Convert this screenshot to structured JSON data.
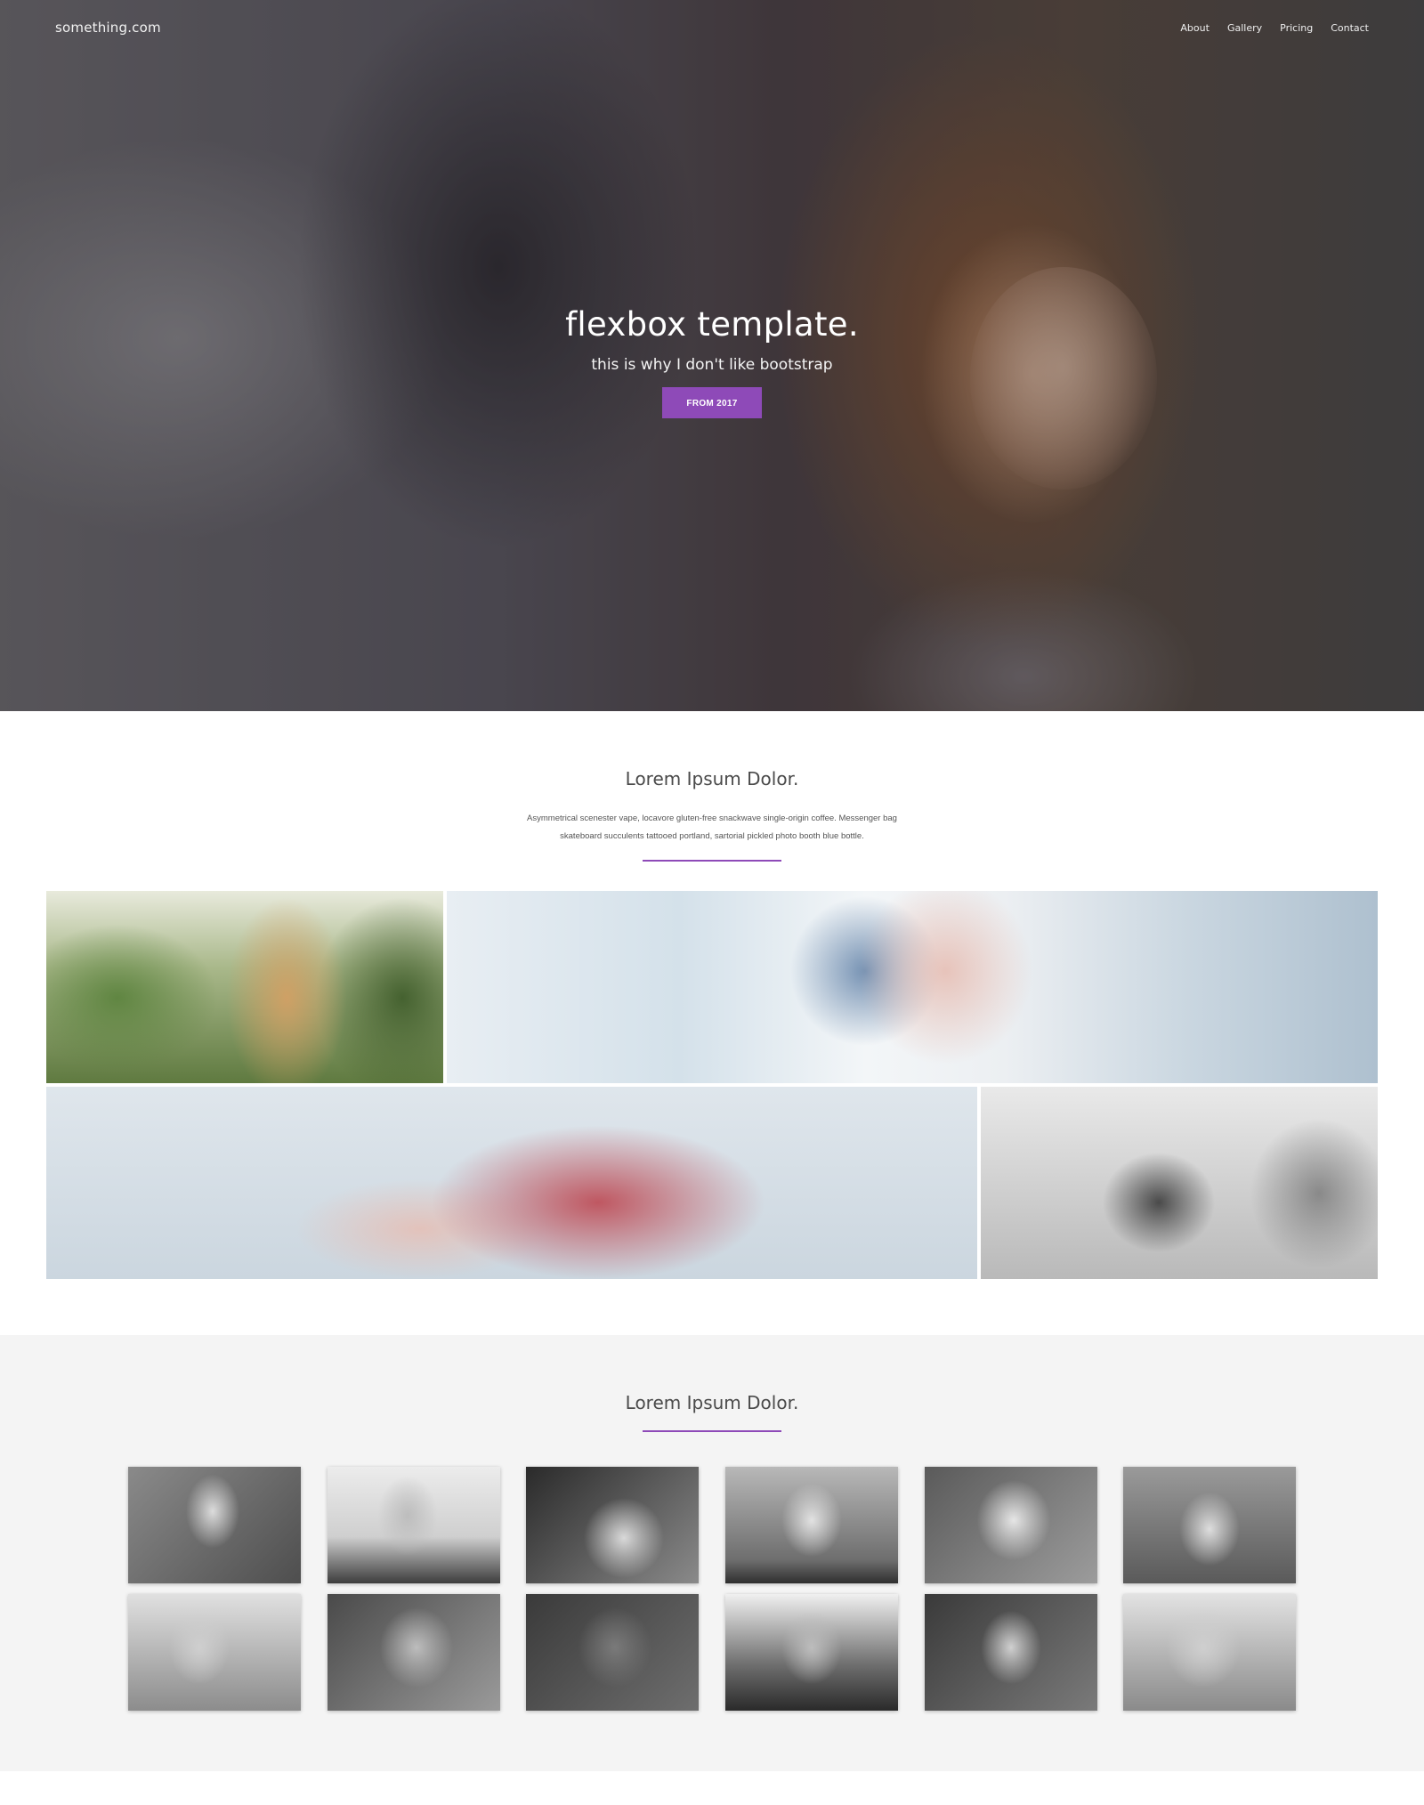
{
  "header": {
    "brand": "something.com",
    "nav": [
      "About",
      "Gallery",
      "Pricing",
      "Contact"
    ]
  },
  "hero": {
    "title": "flexbox template.",
    "subtitle": "this is why I don't like bootstrap",
    "button_label": "FROM 2017"
  },
  "intro_section": {
    "title": "Lorem Ipsum Dolor.",
    "text_line1": "Asymmetrical scenester vape, locavore gluten-free snackwave single-origin coffee. Messenger bag",
    "text_line2": "skateboard succulents tattooed portland, sartorial pickled photo booth blue bottle."
  },
  "team_section": {
    "title": "Lorem Ipsum Dolor."
  },
  "colors": {
    "accent": "#8e4ab8",
    "section_bg": "#f4f4f4"
  }
}
